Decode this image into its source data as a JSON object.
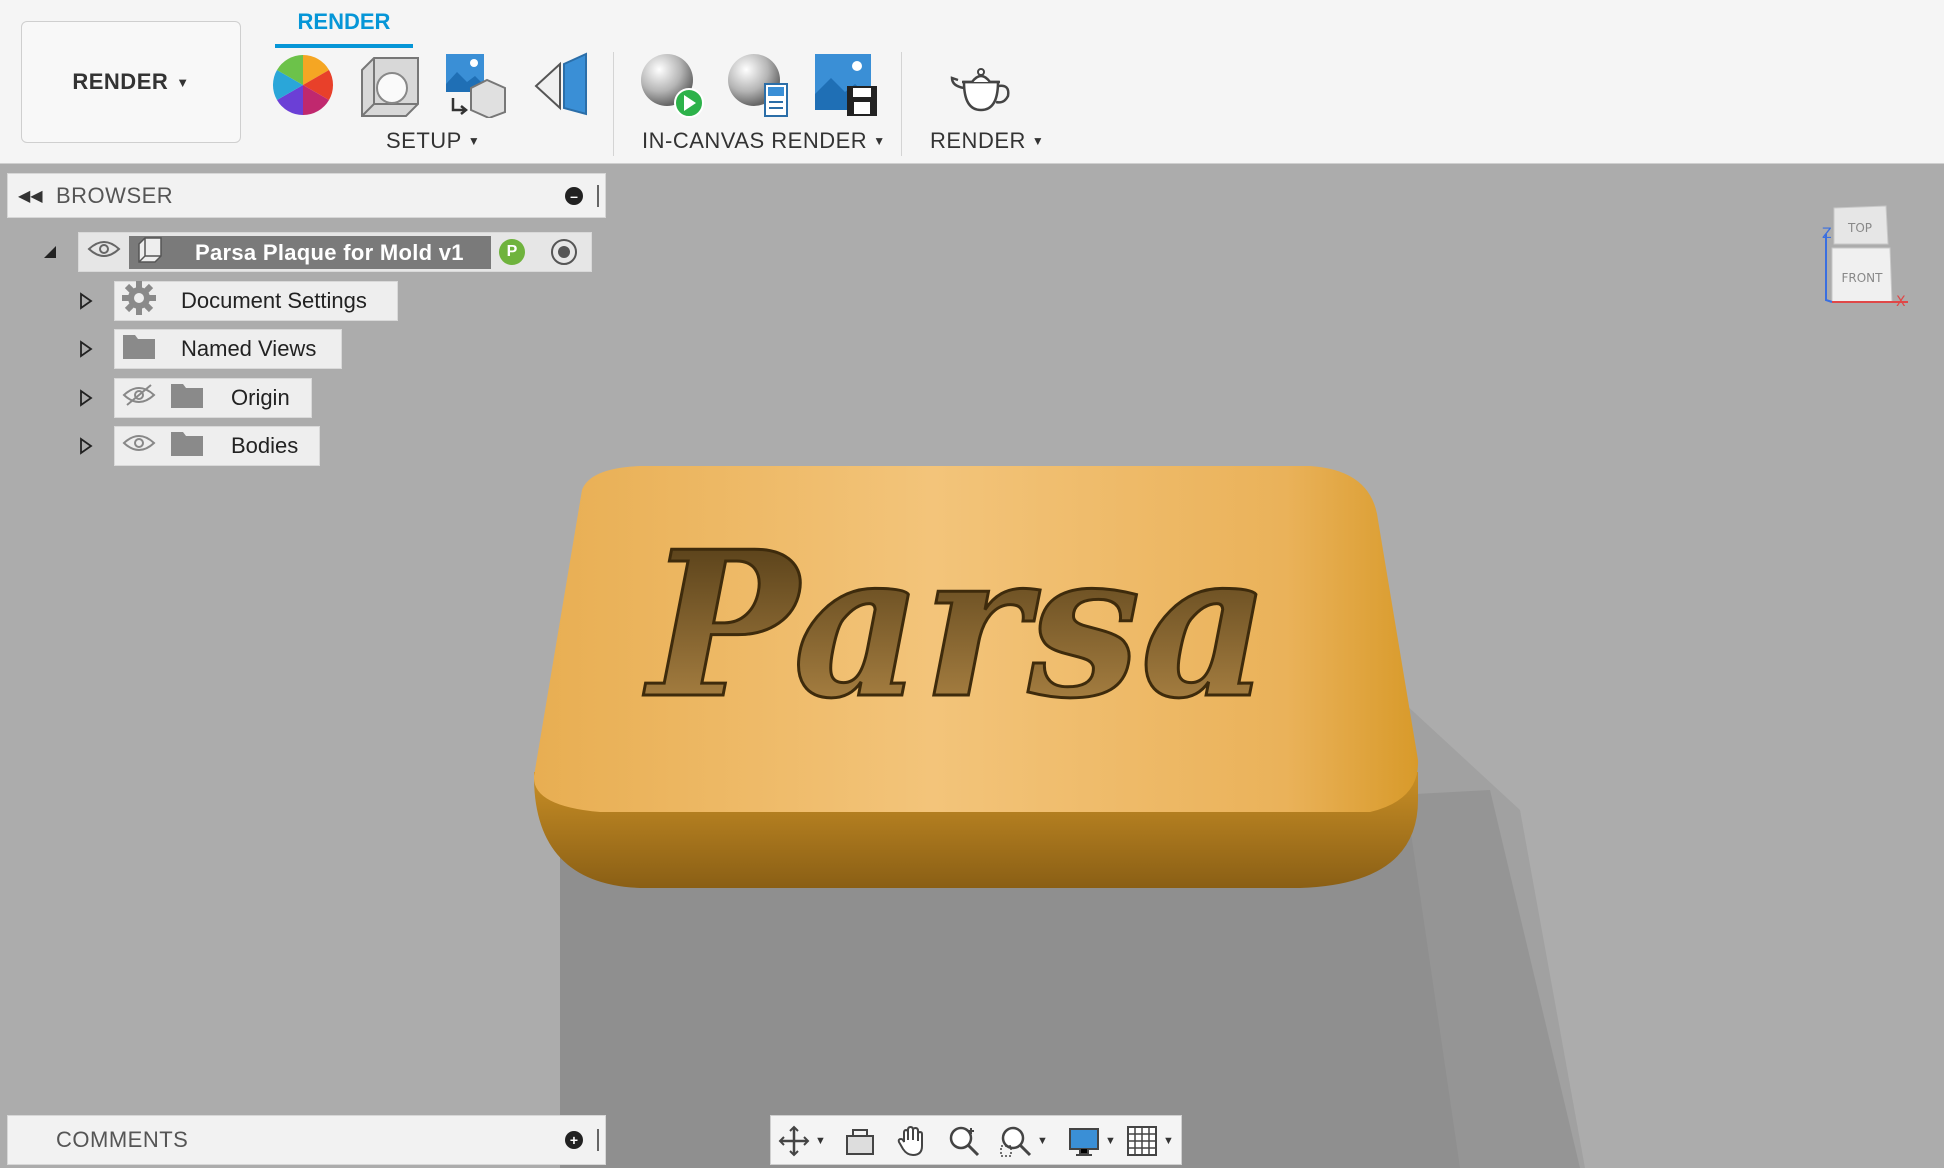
{
  "toolbar": {
    "workspace": "RENDER",
    "active_tab": "RENDER",
    "groups": [
      {
        "label": "SETUP",
        "tools": [
          "appearance-icon",
          "scene-settings-icon",
          "texture-map-icon",
          "decal-icon"
        ]
      },
      {
        "label": "IN-CANVAS RENDER",
        "tools": [
          "in-canvas-render-icon",
          "render-settings-icon",
          "capture-image-icon"
        ]
      },
      {
        "label": "RENDER",
        "tools": [
          "render-teapot-icon"
        ]
      }
    ]
  },
  "browser": {
    "title": "BROWSER",
    "root": {
      "label": "Parsa Plaque for Mold v1",
      "badge": "P"
    },
    "items": [
      {
        "label": "Document Settings",
        "icon": "gear-icon"
      },
      {
        "label": "Named Views",
        "icon": "folder-icon"
      },
      {
        "label": "Origin",
        "icon": "folder-icon",
        "visibility": "hidden"
      },
      {
        "label": "Bodies",
        "icon": "folder-icon",
        "visibility": "visible"
      }
    ]
  },
  "comments": {
    "title": "COMMENTS"
  },
  "viewport": {
    "model_text": "Parsa",
    "model_color": "#e7aa3a",
    "viewcube": {
      "top": "TOP",
      "front": "FRONT",
      "axis_x": "X",
      "axis_z": "Z"
    }
  },
  "colors": {
    "accent": "#0696d7",
    "toolbar_bg": "#f5f5f5",
    "canvas_bg": "#acacac"
  }
}
